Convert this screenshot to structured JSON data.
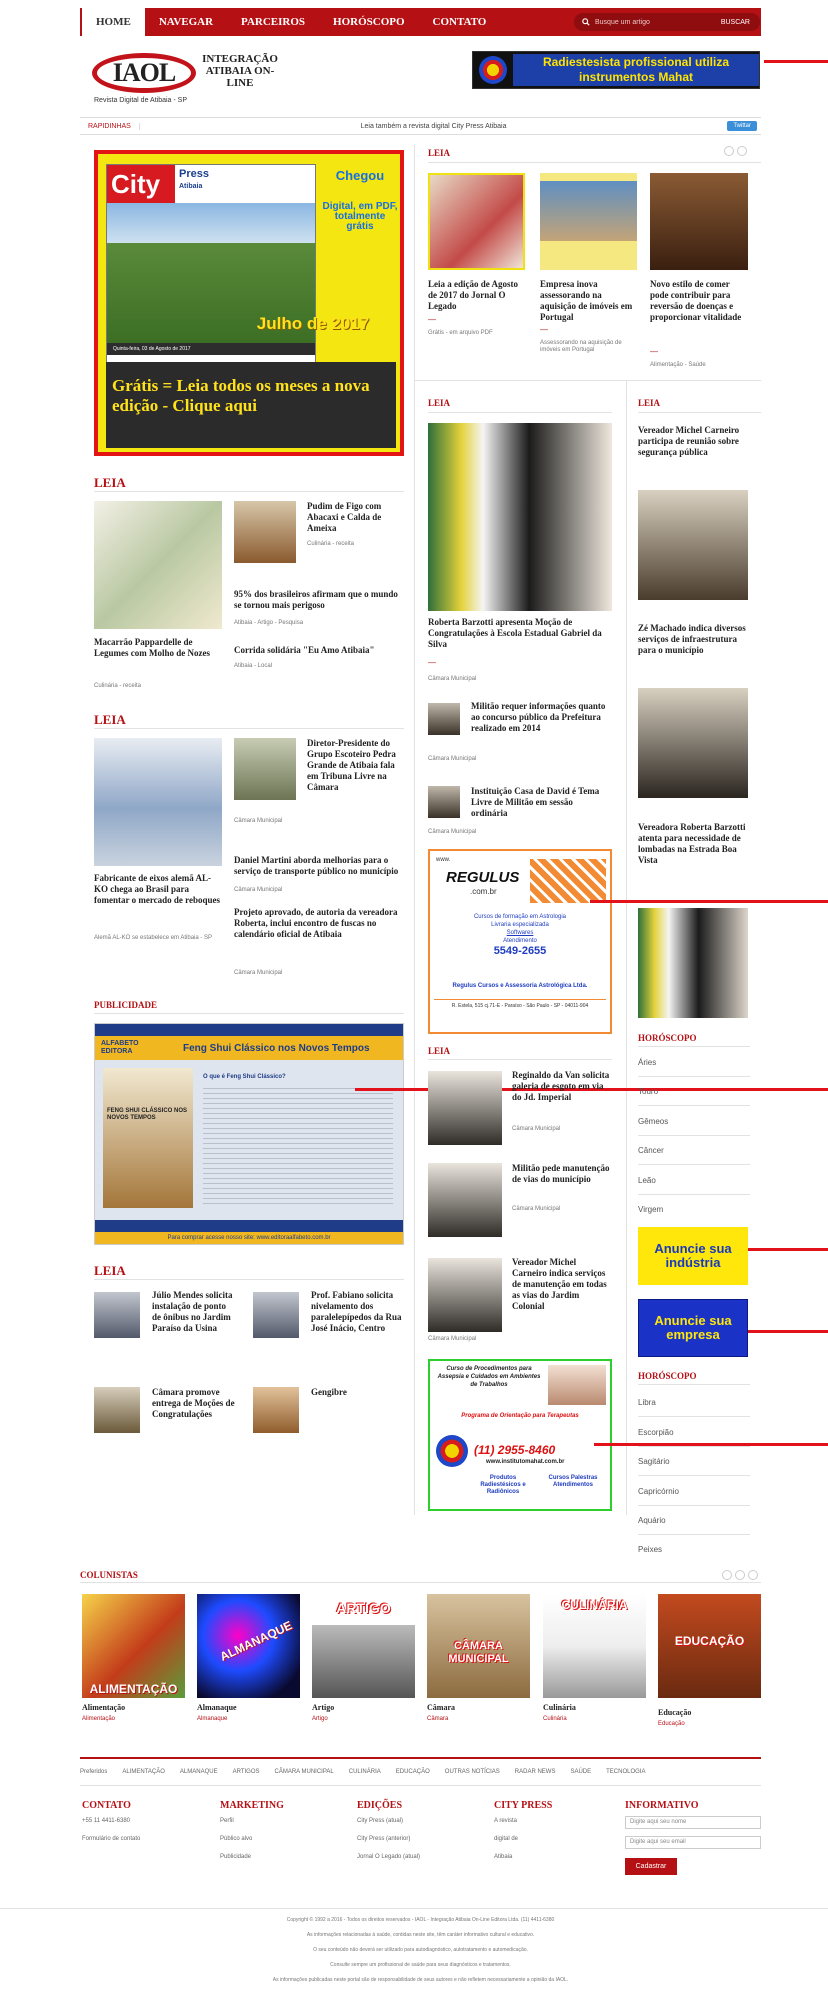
{
  "nav": {
    "items": [
      "HOME",
      "NAVEGAR",
      "PARCEIROS",
      "HORÓSCOPO",
      "CONTATO"
    ],
    "search_placeholder": "Busque um artigo",
    "search_button": "BUSCAR"
  },
  "logo": {
    "mark": "IAOL",
    "title": "INTEGRAÇÃO ATIBAIA ON-LINE",
    "subtitle": "Revista Digital de Atibaia - SP"
  },
  "top_ad": {
    "text": "Radiestesista profissional utiliza instrumentos Mahat"
  },
  "ticker": {
    "label": "RAPIDINHAS",
    "text": "Leia também a revista digital City Press Atibaia",
    "twitter": "Twittar"
  },
  "cover": {
    "city": "City",
    "press": "Press",
    "atibaia": "Atibaia",
    "chegou": "Chegou",
    "digital": "Digital, em PDF, totalmente grátis",
    "julho": "Julho de 2017",
    "date_strip": "Quinta-feira, 03 de Agosto de 2017",
    "cta": "Grátis = Leia todos os meses a nova edição - Clique aqui"
  },
  "leia_left": {
    "heading": "LEIA",
    "main_title": "Macarrão Pappardelle de Legumes com Molho de Nozes",
    "main_meta": "Culinária - receita",
    "items": [
      {
        "title": "Pudim de Figo com Abacaxi e Calda de Ameixa",
        "meta": "Culinária - receita"
      },
      {
        "title": "95% dos brasileiros afirmam que o mundo se tornou mais perigoso",
        "meta": "Atibaia - Artigo - Pesquisa"
      },
      {
        "title": "Corrida solidária \"Eu Amo Atibaia\"",
        "meta": "Atibaia - Local"
      }
    ]
  },
  "leia_left2": {
    "heading": "LEIA",
    "main_title": "Fabricante de eixos alemã AL-KO chega ao Brasil para fomentar o mercado de reboques",
    "main_meta": "Alemã AL-KO se estabelece em Atibaia - SP",
    "items": [
      {
        "title": "Diretor-Presidente do Grupo Escoteiro Pedra Grande de Atibaia fala em Tribuna Livre na Câmara",
        "meta": "Câmara Municipal"
      },
      {
        "title": "Daniel Martini aborda melhorias para o serviço de transporte público no município",
        "meta": "Câmara Municipal"
      },
      {
        "title": "Projeto aprovado, de autoria da vereadora Roberta, inclui encontro de fuscas no calendário oficial de Atibaia",
        "meta": "Câmara Municipal"
      }
    ]
  },
  "publicidade": {
    "heading": "PUBLICIDADE",
    "brand": "ALFABETO EDITORA",
    "title": "Feng Shui Clássico nos Novos Tempos",
    "book": "FENG SHUI CLÁSSICO NOS NOVOS TEMPOS",
    "q": "O que é Feng Shui Clássico?",
    "footer": "Para comprar acesse nosso site: www.editoraalfabeto.com.br"
  },
  "leia_left3": {
    "heading": "LEIA",
    "items": [
      {
        "title": "Júlio Mendes solicita instalação de ponto de ônibus no Jardim Paraíso da Usina"
      },
      {
        "title": "Prof. Fabiano solicita nivelamento dos paralelepípedos da Rua José Inácio, Centro"
      },
      {
        "title": "Câmara promove entrega de Moções de Congratulações"
      },
      {
        "title": "Gengibre"
      }
    ]
  },
  "leia_top": {
    "heading": "LEIA",
    "items": [
      {
        "title": "Leia a edição de Agosto de 2017 do Jornal O Legado",
        "meta": "Grátis - em arquivo PDF"
      },
      {
        "title": "Empresa inova assessorando na aquisição de imóveis em Portugal",
        "meta": "Assessorando na aquisição de imóveis em Portugal"
      },
      {
        "title": "Novo estilo de comer pode contribuir para reversão de doenças e proporcionar vitalidade",
        "meta": "Alimentação - Saúde"
      }
    ]
  },
  "leia_mid": {
    "heading": "LEIA",
    "main_title": "Roberta Barzotti apresenta Moção de Congratulações à Escola Estadual Gabriel da Silva",
    "main_meta": "Câmara Municipal",
    "items": [
      {
        "title": "Militão requer informações quanto ao concurso público da Prefeitura realizado em 2014",
        "meta": "Câmara Municipal"
      },
      {
        "title": "Instituição Casa de David é Tema Livre de Militão em sessão ordinária",
        "meta": "Câmara Municipal"
      }
    ]
  },
  "regulus": {
    "www": "www.",
    "name": "REGULUS",
    "dom": ".com.br",
    "l1": "Cursos de formação em Astrologia",
    "l2": "Livraria especializada",
    "l3": "Softwares",
    "l4": "Atendimento",
    "phone": "5549-2655",
    "company": "Regulus Cursos e Assessoria Astrológica Ltda.",
    "addr": "R. Estela, 515 cj.71-E - Paraíso - São Paulo - SP - 04011-904"
  },
  "leia_mid2": {
    "heading": "LEIA",
    "items": [
      {
        "title": "Reginaldo da Van solicita galeria de esgoto em via do Jd. Imperial",
        "meta": "Câmara Municipal"
      },
      {
        "title": "Militão pede manutenção de vias do município",
        "meta": "Câmara Municipal"
      },
      {
        "title": "Vereador Michel Carneiro indica serviços de manutenção em todas as vias do Jardim Colonial",
        "meta": "Câmara Municipal"
      }
    ]
  },
  "mahat": {
    "l1": "Curso de Procedimentos para Assepsia e Cuidados em Ambientes de Trabalhos",
    "l2": "Programa de Orientação para Terapeutas",
    "phone": "(11) 2955-8460",
    "site": "www.institutomahat.com.br",
    "p1": "Produtos Radiestésicos e Radiônicos",
    "p2": "Cursos Palestras Atendimentos"
  },
  "leia_right": {
    "heading": "LEIA",
    "items": [
      {
        "title": "Vereador Michel Carneiro participa de reunião sobre segurança pública"
      },
      {
        "title": "Zé Machado indica diversos serviços de infraestrutura para o município"
      },
      {
        "title": "Vereadora Roberta Barzotti atenta para necessidade de lombadas na Estrada Boa Vista"
      }
    ]
  },
  "horoscopo1": {
    "heading": "HORÓSCOPO",
    "items": [
      "Áries",
      "Touro",
      "Gêmeos",
      "Câncer",
      "Leão",
      "Virgem"
    ]
  },
  "side_ads": {
    "a1": "Anuncie sua indústria",
    "a2": "Anuncie sua empresa"
  },
  "horoscopo2": {
    "heading": "HORÓSCOPO",
    "items": [
      "Libra",
      "Escorpião",
      "Sagitário",
      "Capricórnio",
      "Aquário",
      "Peixes"
    ]
  },
  "colunistas": {
    "heading": "COLUNISTAS",
    "items": [
      {
        "label": "ALIMENTAÇÃO",
        "title": "Alimentação",
        "sub": "Alimentação"
      },
      {
        "label": "ALMANAQUE",
        "title": "Almanaque",
        "sub": "Almanaque"
      },
      {
        "label": "ARTIGO",
        "title": "Artigo",
        "sub": "Artigo"
      },
      {
        "label": "CÂMARA MUNICIPAL",
        "title": "Câmara",
        "sub": "Câmara"
      },
      {
        "label": "CULINÁRIA",
        "title": "Culinária",
        "sub": "Culinária"
      },
      {
        "label": "EDUCAÇÃO",
        "title": "Educação",
        "sub": "Educação"
      }
    ]
  },
  "bottom_nav": [
    "Preferidos",
    "ALIMENTAÇÃO",
    "ALMANAQUE",
    "ARTIGOS",
    "CÂMARA MUNICIPAL",
    "CULINÁRIA",
    "EDUCAÇÃO",
    "OUTRAS NOTÍCIAS",
    "RADAR NEWS",
    "SAÚDE",
    "TECNOLOGIA"
  ],
  "footer": {
    "contato": {
      "h": "CONTATO",
      "l1": "+55 11 4411-6380",
      "l2": "Formulário de contato"
    },
    "marketing": {
      "h": "MARKETING",
      "l1": "Perfil",
      "l2": "Público alvo",
      "l3": "Publicidade"
    },
    "edicoes": {
      "h": "EDIÇÕES",
      "l1": "City Press (atual)",
      "l2": "City Press (anterior)",
      "l3": "Jornal O Legado (atual)"
    },
    "citypress": {
      "h": "CITY PRESS",
      "l1": "A revista",
      "l2": "digital de",
      "l3": "Atibaia"
    },
    "informativo": {
      "h": "INFORMATIVO",
      "name": "Digite aqui seu nome",
      "email": "Digite aqui seu email",
      "btn": "Cadastrar"
    }
  },
  "copyright": [
    "Copyright © 1992 a 2016 - Todos os direitos reservados - IAOL - Integração Atibaia On-Line Editora Ltda. (11) 4411-6380",
    "As informações relacionadas à saúde, contidas neste site, têm caráter informativo cultural e educativo.",
    "O seu conteúdo não deverá ser utilizado para autodiagnóstico, autotratamento e automedicação.",
    "Consulte sempre um profissional de saúde para seus diagnósticos e tratamentos.",
    "As informações publicadas neste portal são de responsabilidade de seus autores e não refletem necessariamente a opinião da IAOL."
  ]
}
